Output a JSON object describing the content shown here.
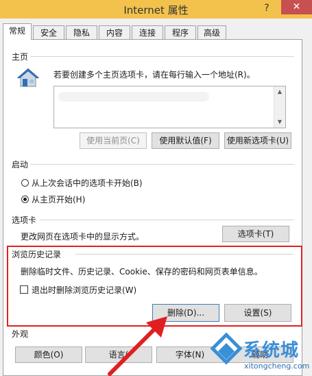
{
  "window": {
    "title": "Internet 属性",
    "help_glyph": "?",
    "close_glyph": "✕"
  },
  "tabs": [
    "常规",
    "安全",
    "隐私",
    "内容",
    "连接",
    "程序",
    "高级"
  ],
  "home": {
    "section": "主页",
    "instruction": "若要创建多个主页选项卡，请在每行输入一个地址(R)。",
    "btn_current": "使用当前页(C)",
    "btn_default": "使用默认值(F)",
    "btn_newtab": "使用新选项卡(U)"
  },
  "startup": {
    "section": "启动",
    "option_last": "从上次会话中的选项卡开始(B)",
    "option_home": "从主页开始(H)",
    "selected": "option_home"
  },
  "tabs_section": {
    "section": "选项卡",
    "description": "更改网页在选项卡中的显示方式。",
    "btn_tabs": "选项卡(T)"
  },
  "history": {
    "section": "浏览历史记录",
    "description": "删除临时文件、历史记录、Cookie、保存的密码和网页表单信息。",
    "checkbox_label": "退出时删除浏览历史记录(W)",
    "checked": false,
    "btn_delete": "删除(D)...",
    "btn_settings": "设置(S)"
  },
  "appearance": {
    "section": "外观",
    "btn_colors": "颜色(O)",
    "btn_languages": "语言(",
    "btn_fonts": "字体(N)",
    "btn_accessibility": "辅助"
  },
  "watermark": {
    "brand": "系统城",
    "url": "xitongcheng.com"
  },
  "colors": {
    "titlebar": "#f3c24d",
    "close": "#c75050",
    "highlight": "#e02020",
    "arrow": "#e02020"
  }
}
